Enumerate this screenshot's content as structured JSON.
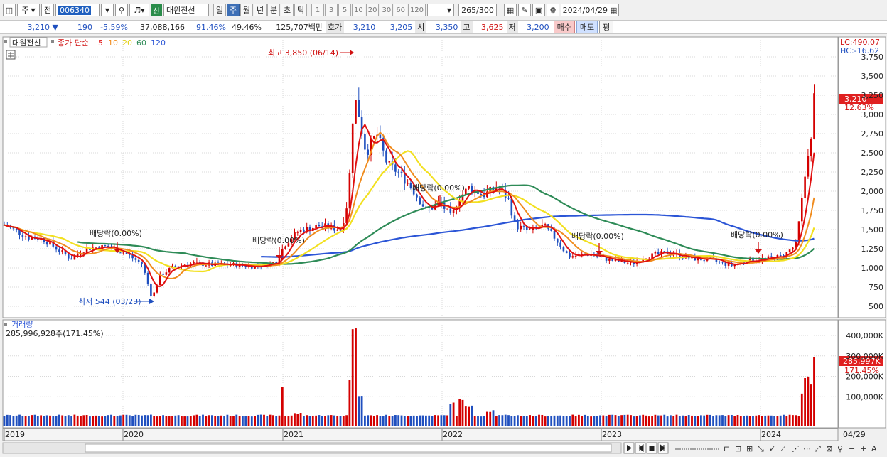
{
  "toolbar": {
    "type_select": "주",
    "prefix": "전",
    "stock_code": "006340",
    "new_badge": "신",
    "stock_name": "대원전선",
    "periods": [
      "일",
      "주",
      "월",
      "년",
      "분",
      "초",
      "틱"
    ],
    "selected_period": "주",
    "intervals": [
      "1",
      "3",
      "5",
      "10",
      "20",
      "30",
      "60",
      "120"
    ],
    "count_display": "265",
    "count_total": "/300",
    "date": "2024/04/29"
  },
  "quote": {
    "price": "3,210",
    "change": "190",
    "change_pct": "-5.59%",
    "volume": "37,088,166",
    "ratio1": "91.46%",
    "ratio2": "49.46%",
    "amount": "125,707백만",
    "bid_label": "호가",
    "bid1": "3,210",
    "bid2": "3,205",
    "open_label": "시",
    "open": "3,350",
    "high_label": "고",
    "high": "3,625",
    "low_label": "저",
    "low": "3,200",
    "buy_button": "매수",
    "sell_button": "매도",
    "eval_button": "평"
  },
  "legend": {
    "name": "대원전선",
    "ma_label": "종가 단순",
    "ma_periods": [
      "5",
      "10",
      "20",
      "60",
      "120"
    ]
  },
  "colors": {
    "up": "#d40000",
    "down": "#1f4fbf",
    "ma5": "#e01010",
    "ma10": "#f08c1e",
    "ma20": "#f2e020",
    "ma60": "#2e8b57",
    "ma120": "#2b55d6",
    "current_box": "#e02020"
  },
  "price_axis": {
    "lc": "LC:490.07",
    "hc": "HC:-16.62",
    "ticks": [
      "3,750",
      "3,500",
      "3,250",
      "3,000",
      "2,750",
      "2,500",
      "2,250",
      "2,000",
      "1,750",
      "1,500",
      "1,250",
      "1,000",
      "750",
      "500"
    ],
    "current_price": "3,210",
    "current_pct": "12.63%"
  },
  "annotations": {
    "high": "최고 3,850 (06/14)",
    "low": "최저 544 (03/23)",
    "dividends": [
      "배당락(0.00%)",
      "배당락(0.00%)",
      "배당락(0.00%)",
      "배당락(0.00%)",
      "배당락(0.00%)"
    ]
  },
  "volume_panel": {
    "title": "거래량",
    "value": "285,996,928주(171.45%)",
    "ticks": [
      "400,000K",
      "300,000K",
      "200,000K",
      "100,000K"
    ],
    "current": "285,997K",
    "current_pct": "171.45%"
  },
  "x_axis": {
    "labels": [
      "2019",
      "2020",
      "2021",
      "2022",
      "2023",
      "2024"
    ],
    "right_label": "04/29"
  }
}
